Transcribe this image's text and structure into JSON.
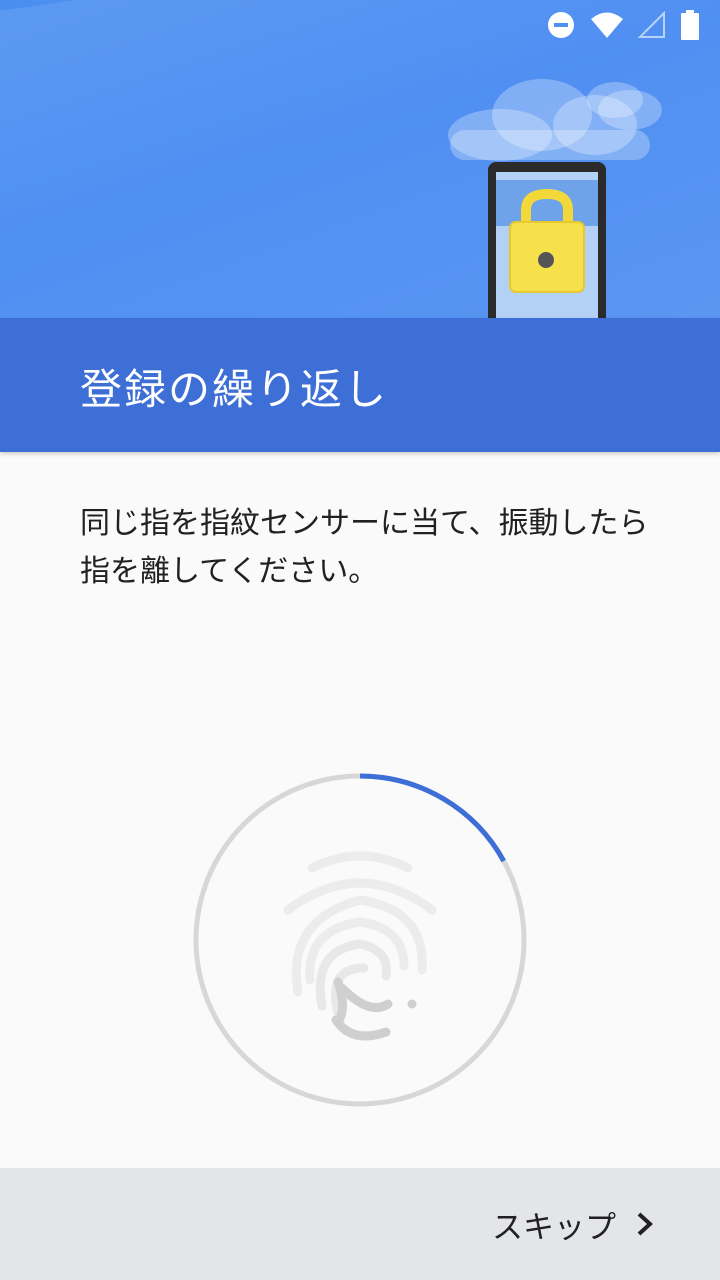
{
  "header": {
    "title": "登録の繰り返し"
  },
  "status_bar": {
    "icons": [
      "do-not-disturb-icon",
      "wifi-icon",
      "cellular-signal-icon",
      "battery-icon"
    ]
  },
  "illustration": {
    "icon": "tablet-lock-icon"
  },
  "body": {
    "instruction": "同じ指を指紋センサーに当て、振動したら指を離してください。"
  },
  "progress": {
    "fraction": 0.17,
    "icon": "fingerprint-icon"
  },
  "footer": {
    "skip_label": "スキップ",
    "skip_icon": "chevron-right-icon"
  },
  "colors": {
    "accent": "#3d6fd6",
    "hero": "#4f8ff2",
    "lock": "#f6e04b",
    "ring_track": "#d7d7d7",
    "footer_bg": "#e3e5e8"
  }
}
